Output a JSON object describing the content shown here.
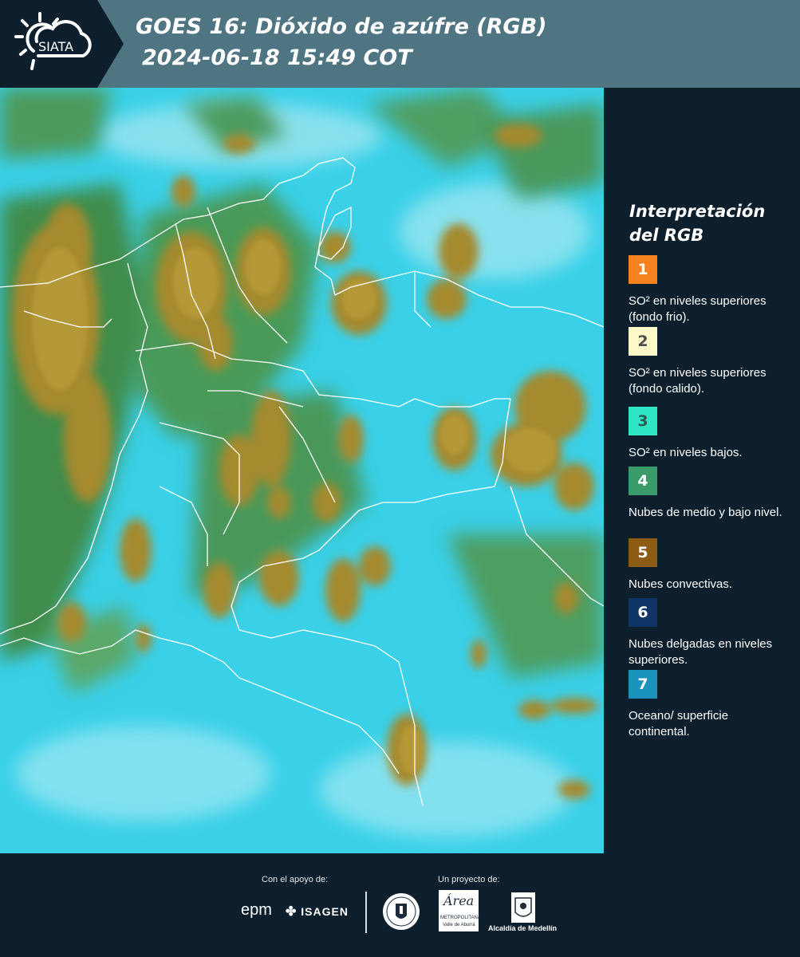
{
  "header": {
    "logo_text": "SIATA",
    "title_line1": "GOES 16: Dióxido de azúfre (RGB)",
    "title_line2": "2024-06-18 15:49 COT"
  },
  "legend": {
    "title_line1": "Interpretación",
    "title_line2": "del RGB",
    "items": [
      {
        "number": "1",
        "label": "SO² en niveles superiores (fondo frio).",
        "color": "#f5821f",
        "text_color": "#ffffff"
      },
      {
        "number": "2",
        "label": "SO² en niveles superiores (fondo calido).",
        "color": "#fef9c8",
        "text_color": "#4d4d4d"
      },
      {
        "number": "3",
        "label": "SO² en niveles bajos.",
        "color": "#2ee6c4",
        "text_color": "#2a5a55"
      },
      {
        "number": "4",
        "label": "Nubes de medio y bajo nivel.",
        "color": "#3a9a6a",
        "text_color": "#ffffff"
      },
      {
        "number": "5",
        "label": "Nubes convectivas.",
        "color": "#8c5c14",
        "text_color": "#ffffff"
      },
      {
        "number": "6",
        "label": "Nubes delgadas en niveles superiores.",
        "color": "#0f3566",
        "text_color": "#ffffff"
      },
      {
        "number": "7",
        "label": "Oceano/ superficie continental.",
        "color": "#1a93bd",
        "text_color": "#ffffff"
      }
    ]
  },
  "footer": {
    "support_label": "Con el apoyo de:",
    "project_label": "Un proyecto de:",
    "sponsors": [
      "epm",
      "ISAGEN"
    ],
    "partner_labels": [
      "Área",
      "METROPOLITANA",
      "Valle de Aburrá"
    ],
    "alcaldia_label": "Alcaldía de Medellín"
  },
  "map": {
    "ocean_color": "#39d0e8",
    "cloud_color": "#a58a2e",
    "vegetation_color": "#3f8c4c",
    "border_color": "#ffffff"
  }
}
